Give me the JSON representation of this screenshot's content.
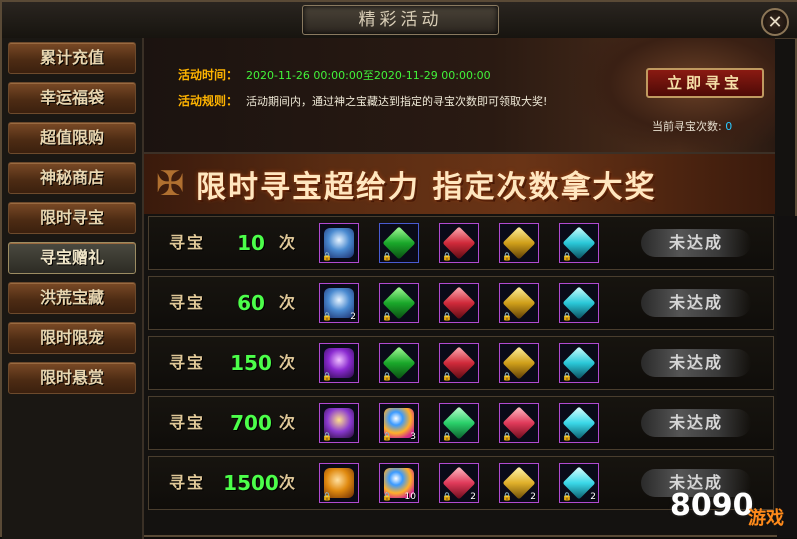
{
  "window": {
    "title": "精彩活动",
    "close_icon": "close-icon"
  },
  "sidebar": {
    "items": [
      {
        "label": "累计充值",
        "active": false
      },
      {
        "label": "幸运福袋",
        "active": false
      },
      {
        "label": "超值限购",
        "active": false
      },
      {
        "label": "神秘商店",
        "active": false
      },
      {
        "label": "限时寻宝",
        "active": false
      },
      {
        "label": "寻宝赠礼",
        "active": true
      },
      {
        "label": "洪荒宝藏",
        "active": false
      },
      {
        "label": "限时限宠",
        "active": false
      },
      {
        "label": "限时悬赏",
        "active": false
      }
    ]
  },
  "info": {
    "time_label": "活动时间：",
    "time_value": "2020-11-26 00:00:00至2020-11-29 00:00:00",
    "rule_label": "活动规则：",
    "rule_value": "活动期间内，通过神之宝藏达到指定的寻宝次数即可领取大奖!",
    "button_label": "立即寻宝",
    "count_label": "当前寻宝次数:",
    "count_value": "0"
  },
  "banner": {
    "text": "限时寻宝超给力 指定次数拿大奖"
  },
  "colors": {
    "accent_gold": "#ffb400",
    "green_count": "#4cff4a",
    "cyan_value": "#29c8ff",
    "time_green": "#42f23a"
  },
  "tiers": [
    {
      "prefix": "寻宝",
      "count": "10",
      "suffix": "次",
      "status": "未达成",
      "items": [
        {
          "icon": "armor-icon",
          "frame": "purple",
          "qty": ""
        },
        {
          "icon": "green-gem-icon",
          "frame": "blue",
          "qty": ""
        },
        {
          "icon": "red-gem-icon",
          "frame": "purple",
          "qty": ""
        },
        {
          "icon": "gold-gem-icon",
          "frame": "purple",
          "qty": ""
        },
        {
          "icon": "cyan-gem-icon",
          "frame": "purple",
          "qty": ""
        }
      ]
    },
    {
      "prefix": "寻宝",
      "count": "60",
      "suffix": "次",
      "status": "未达成",
      "items": [
        {
          "icon": "armor-icon",
          "frame": "purple",
          "qty": "2"
        },
        {
          "icon": "green-gem-icon",
          "frame": "purple",
          "qty": ""
        },
        {
          "icon": "red-gem-icon",
          "frame": "purple",
          "qty": ""
        },
        {
          "icon": "gold-gem-icon",
          "frame": "purple",
          "qty": ""
        },
        {
          "icon": "cyan-gem-icon",
          "frame": "purple",
          "qty": ""
        }
      ]
    },
    {
      "prefix": "寻宝",
      "count": "150",
      "suffix": "次",
      "status": "未达成",
      "items": [
        {
          "icon": "purple-armor-icon",
          "frame": "purple",
          "qty": ""
        },
        {
          "icon": "green-gem-icon",
          "frame": "purple",
          "qty": ""
        },
        {
          "icon": "red-gem-icon",
          "frame": "purple",
          "qty": ""
        },
        {
          "icon": "gold-gem-icon",
          "frame": "purple",
          "qty": ""
        },
        {
          "icon": "cyan-gem-icon",
          "frame": "purple",
          "qty": ""
        }
      ]
    },
    {
      "prefix": "寻宝",
      "count": "700",
      "suffix": "次",
      "status": "未达成",
      "items": [
        {
          "icon": "gold-armor-icon",
          "frame": "purple",
          "qty": ""
        },
        {
          "icon": "rainbow-orb-icon",
          "frame": "purple",
          "qty": "3"
        },
        {
          "icon": "green-crystal-icon",
          "frame": "purple",
          "qty": ""
        },
        {
          "icon": "red-crystal-icon",
          "frame": "purple",
          "qty": ""
        },
        {
          "icon": "cyan-crystal-icon",
          "frame": "purple",
          "qty": ""
        }
      ]
    },
    {
      "prefix": "寻宝",
      "count": "1500",
      "suffix": "次",
      "status": "未达成",
      "items": [
        {
          "icon": "amber-stone-icon",
          "frame": "purple",
          "qty": ""
        },
        {
          "icon": "rainbow-orb-icon",
          "frame": "purple",
          "qty": "10"
        },
        {
          "icon": "red-crystal-icon",
          "frame": "purple",
          "qty": "2"
        },
        {
          "icon": "gold-crystal-icon",
          "frame": "purple",
          "qty": "2"
        },
        {
          "icon": "cyan-crystal-icon",
          "frame": "purple",
          "qty": "2"
        }
      ]
    }
  ],
  "watermark": {
    "number": "8090",
    "label": "游戏"
  }
}
